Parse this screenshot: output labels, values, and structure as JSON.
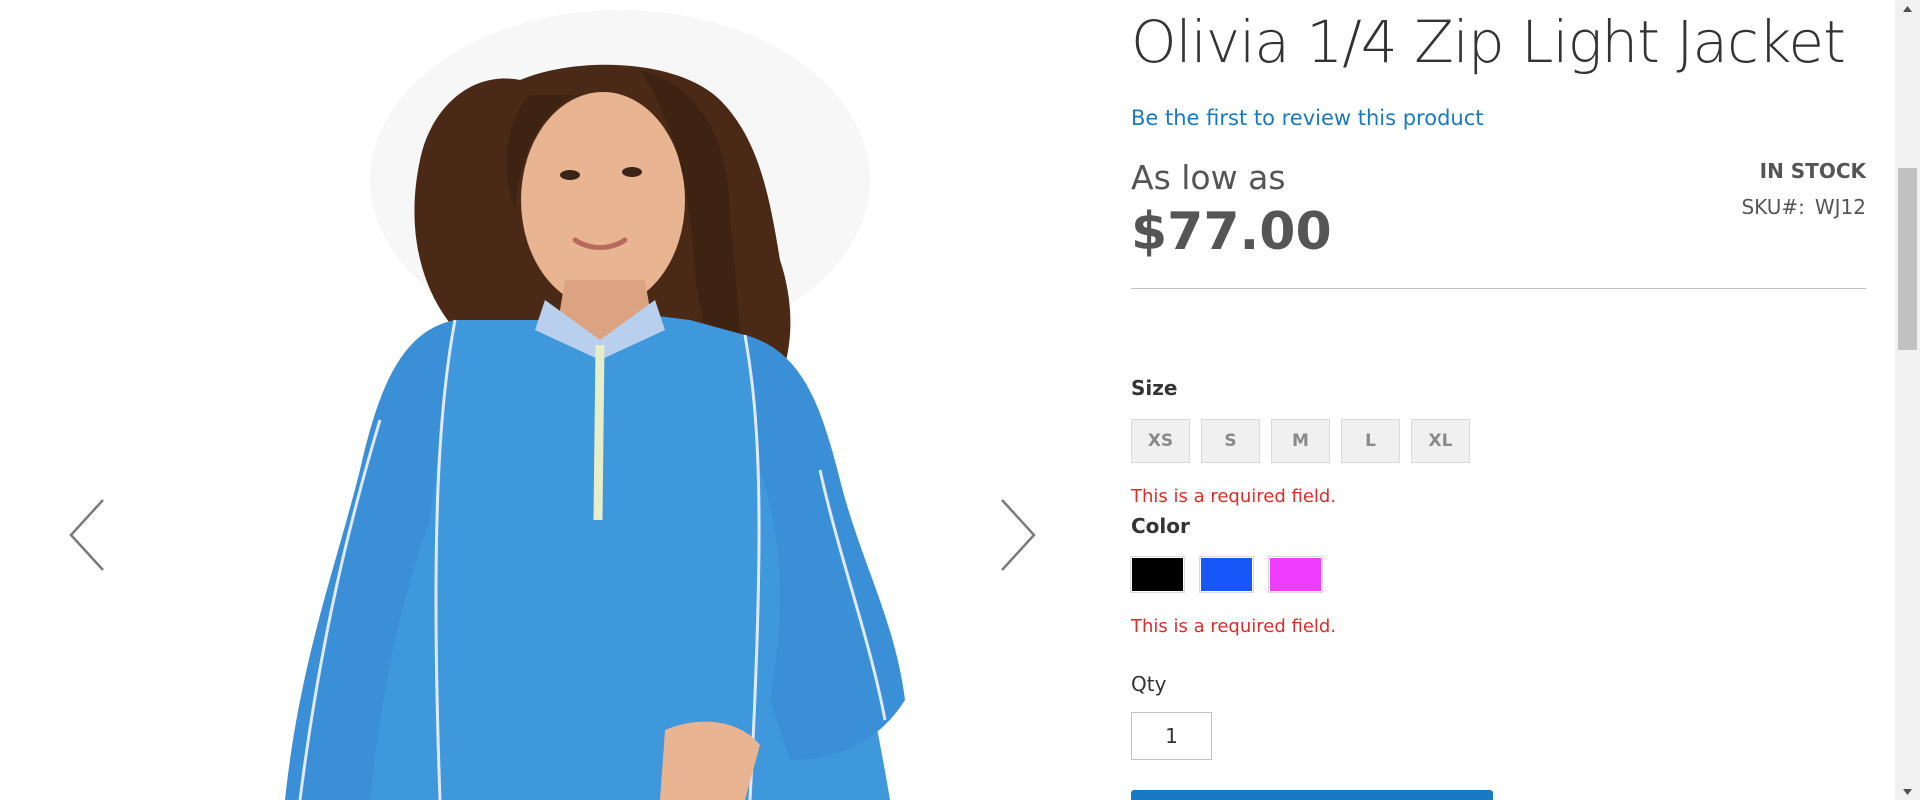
{
  "product": {
    "name": "Olivia 1/4 Zip Light Jacket",
    "review_link": "Be the first to review this product",
    "price_prefix": "As low as",
    "price": "$77.00",
    "stock": "IN STOCK",
    "sku_label": "SKU#:",
    "sku": "WJ12",
    "image_icon": "product-photo-woman-blue-quarter-zip-jacket"
  },
  "options": {
    "size_label": "Size",
    "sizes": [
      "XS",
      "S",
      "M",
      "L",
      "XL"
    ],
    "size_error": "This is a required field.",
    "color_label": "Color",
    "colors": [
      {
        "name": "Black",
        "hex": "#000000"
      },
      {
        "name": "Blue",
        "hex": "#1857f7"
      },
      {
        "name": "Purple",
        "hex": "#ef3dff"
      }
    ],
    "color_error": "This is a required field.",
    "qty_label": "Qty",
    "qty_value": "1"
  },
  "gallery": {
    "prev_icon": "chevron-left-icon",
    "next_icon": "chevron-right-icon"
  },
  "colors": {
    "link": "#1979c3",
    "error": "#e02b27",
    "primary_button": "#1979c3",
    "jacket": "#3f97dc"
  }
}
